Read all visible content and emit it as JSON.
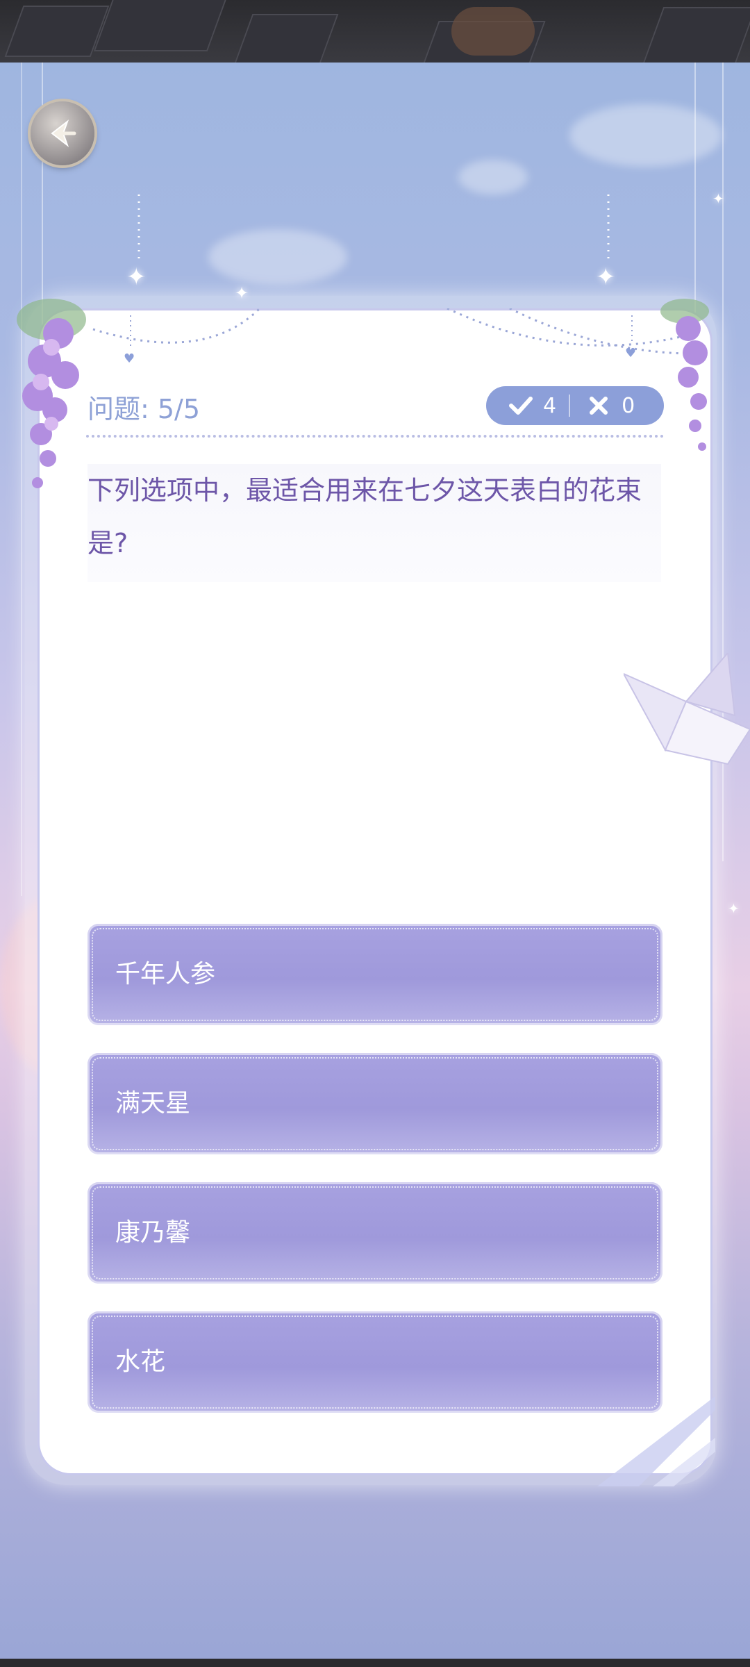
{
  "quiz": {
    "progress_label": "问题: 5/5",
    "correct_count": "4",
    "wrong_count": "0",
    "question": "下列选项中，最适合用来在七夕这天表白的花束是?",
    "options": [
      {
        "label": "千年人参"
      },
      {
        "label": "满天星"
      },
      {
        "label": "康乃馨"
      },
      {
        "label": "水花"
      }
    ]
  },
  "icons": {
    "back": "back-arrow-icon",
    "correct": "check-icon",
    "wrong": "cross-icon"
  },
  "colors": {
    "accent": "#8c9fd9",
    "option_fill": "#a39ddd",
    "question_text": "#6d56a8",
    "progress_text": "#8ea1d6"
  }
}
